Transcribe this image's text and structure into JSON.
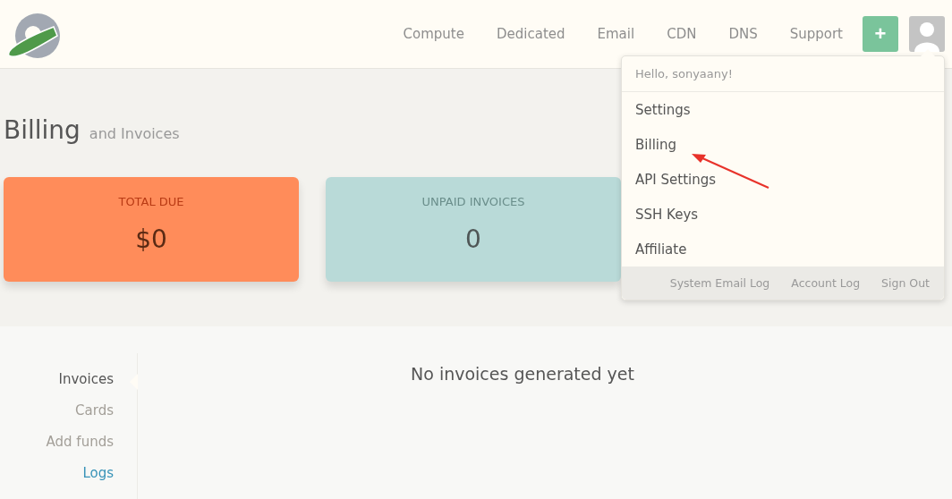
{
  "nav": {
    "links": [
      "Compute",
      "Dedicated",
      "Email",
      "CDN",
      "DNS",
      "Support"
    ],
    "add_button": "+"
  },
  "user_menu": {
    "open": true,
    "greeting": "Hello, sonyaany!",
    "items": [
      {
        "label": "Settings",
        "pointed": false
      },
      {
        "label": "Billing",
        "pointed": true
      },
      {
        "label": "API Settings",
        "pointed": false
      },
      {
        "label": "SSH Keys",
        "pointed": false
      },
      {
        "label": "Affiliate",
        "pointed": false
      }
    ],
    "footer_links": [
      "System Email Log",
      "Account Log",
      "Sign Out"
    ]
  },
  "page_title": {
    "main": "Billing",
    "sub": "and Invoices"
  },
  "summary_cards": [
    {
      "kind": "due",
      "label": "TOTAL DUE",
      "value": "$0"
    },
    {
      "kind": "unpaid",
      "label": "UNPAID INVOICES",
      "value": "0"
    }
  ],
  "sidebar": {
    "items": [
      {
        "label": "Invoices",
        "selected": true,
        "hovered": false
      },
      {
        "label": "Cards",
        "selected": false,
        "hovered": false
      },
      {
        "label": "Add funds",
        "selected": false,
        "hovered": false
      },
      {
        "label": "Logs",
        "selected": false,
        "hovered": true
      }
    ]
  },
  "empty_message": "No invoices generated yet"
}
